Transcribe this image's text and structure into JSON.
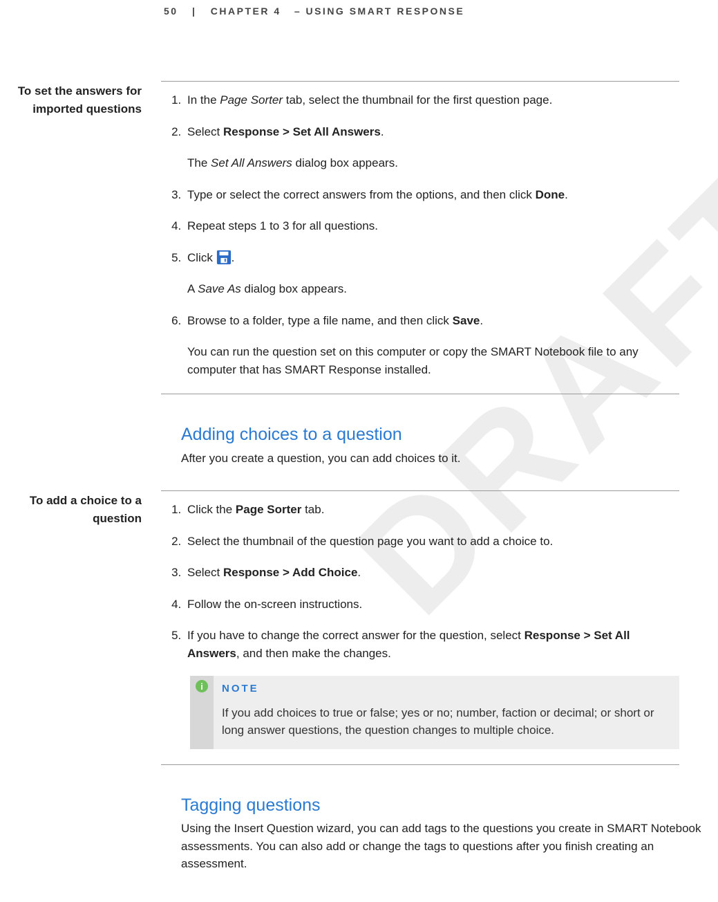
{
  "header": {
    "page_num": "50",
    "chapter_label": "CHAPTER 4",
    "chapter_title": "– USING SMART RESPONSE"
  },
  "watermark": "DRAFT",
  "section1": {
    "side_l1": "To set the answers for",
    "side_l2": "imported questions",
    "s1_pre": "In the ",
    "s1_it": "Page Sorter",
    "s1_post": " tab, select the thumbnail for the first question page.",
    "s2_pre": "Select ",
    "s2_b": "Response > Set All Answers",
    "s2_post": ".",
    "s2_sub_pre": "The ",
    "s2_sub_it": "Set All Answers",
    "s2_sub_post": " dialog box appears.",
    "s3_pre": "Type or select the correct answers from the options, and then click ",
    "s3_b": "Done",
    "s3_post": ".",
    "s4": "Repeat steps 1 to 3 for all questions.",
    "s5_pre": "Click ",
    "s5_post": ".",
    "s5_sub_pre": "A ",
    "s5_sub_it": "Save As",
    "s5_sub_post": " dialog box appears.",
    "s6_pre": "Browse to a folder, type a file name, and then click ",
    "s6_b": "Save",
    "s6_post": ".",
    "s6_sub": "You can run the question set on this computer or copy the SMART Notebook file to any computer that has SMART Response installed."
  },
  "heading2": "Adding choices to a question",
  "heading2_sub": "After you create a question, you can add choices to it.",
  "section2": {
    "side_l1": "To add a choice to a",
    "side_l2": "question",
    "s1_pre": "Click the ",
    "s1_b": "Page Sorter",
    "s1_post": " tab.",
    "s2": "Select the thumbnail of the question page you want to add a choice to.",
    "s3_pre": "Select ",
    "s3_b": "Response > Add Choice",
    "s3_post": ".",
    "s4": "Follow the on-screen instructions.",
    "s5_pre": "If you have to change the correct answer for the question, select ",
    "s5_b": "Response > Set All Answers",
    "s5_post": ", and then make the changes.",
    "note_label": "NOTE",
    "note_body": "If you add choices to true or false; yes or no; number, faction or decimal; or short or long answer questions, the question changes to multiple choice."
  },
  "heading3": "Tagging questions",
  "heading3_sub": "Using the Insert Question wizard, you can add tags to the questions you create in SMART Notebook assessments. You can also add or change the tags to questions after you finish creating an assessment."
}
